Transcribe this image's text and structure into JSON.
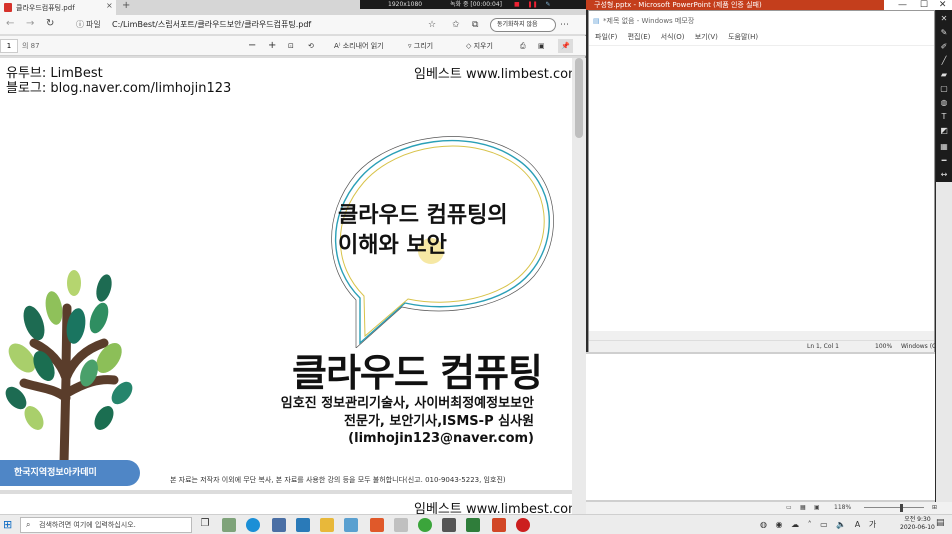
{
  "edge": {
    "tab_title": "클라우드컴퓨팅.pdf",
    "address_prefix": "파일",
    "address": "C:/LimBest/스립서포트/클라우드보안/클라우드컴퓨팅.pdf",
    "sync_label": "동기화하지 않음",
    "nav_back": "←",
    "nav_forward": "→",
    "nav_refresh": "↻",
    "page_number": "1",
    "page_total": "의 87",
    "zoom_out": "−",
    "zoom_in": "+",
    "read_aloud": "소리내어 읽기",
    "draw": "그리기",
    "erase": "지우기"
  },
  "pdf": {
    "youtube_line": "유투브: LimBest",
    "blog_line": "블로그: blog.naver.com/limhojin123",
    "brand_top": "임베스트 www.limbest.com",
    "subtitle_line1": "클라우드 컴퓨팅의",
    "subtitle_line2": "이해와 보안",
    "title": "클라우드 컴퓨팅",
    "author_line1": "임호진 정보관리기술사, 사이버최정예정보보안",
    "author_line2": "전문가, 보안기사,ISMS-P 심사원",
    "author_line3": "(limhojin123@naver.com)",
    "academy": "한국지역정보아카데미",
    "copyright": "본 자료는 저작자 이외에 무단 복사, 본 자료를 사용한 강의 등을 모두 불허합니다(신고. 010-9043-5223, 임호진)",
    "next_page_brand": "임베스트 www.limbest.com"
  },
  "recording": {
    "resolution": "1920x1080",
    "status": "녹화 중 [00:00:04]"
  },
  "powerpoint": {
    "title": "구성형.pptx - Microsoft PowerPoint (제품 인증 실패)"
  },
  "notepad": {
    "title": "*제목 없음 - Windows 메모장",
    "menu": [
      "파일(F)",
      "편집(E)",
      "서식(O)",
      "보기(V)",
      "도움말(H)"
    ],
    "status_position": "Ln 1, Col 1",
    "status_zoom": "100%",
    "status_encoding": "Windows (CRLF)"
  },
  "ppt_status": {
    "zoom": "118%"
  },
  "taskbar": {
    "search_placeholder": "검색하려면 여기에 입력하십시오.",
    "time": "오전 9:30",
    "date": "2020-06-10",
    "ime": "A",
    "lang": "가"
  },
  "colors": {
    "ppt_red": "#c43e1c",
    "academy_blue": "#4f86c6",
    "pdf_icon_red": "#d6322b",
    "taskbar_bg": "#ececec"
  }
}
